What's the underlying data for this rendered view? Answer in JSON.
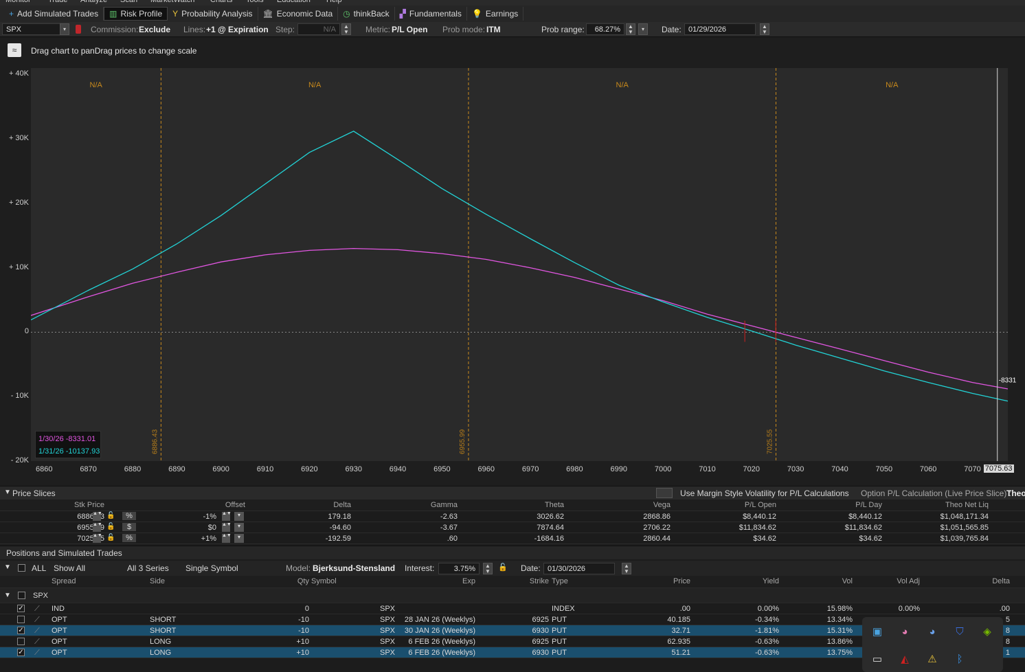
{
  "menubar": {
    "items": [
      "Monitor",
      "Trade",
      "Analyze",
      "Scan",
      "MarketWatch",
      "Charts",
      "Tools",
      "Education",
      "Help"
    ]
  },
  "toolbar": {
    "items": [
      {
        "label": "Add Simulated Trades",
        "icon": "plus-icon"
      },
      {
        "label": "Risk Profile",
        "icon": "risk-profile-icon"
      },
      {
        "label": "Probability Analysis",
        "icon": "probability-icon"
      },
      {
        "label": "Economic Data",
        "icon": "bank-icon"
      },
      {
        "label": "thinkBack",
        "icon": "clock-icon"
      },
      {
        "label": "Fundamentals",
        "icon": "blocks-icon"
      },
      {
        "label": "Earnings",
        "icon": "lightbulb-icon"
      }
    ]
  },
  "controls": {
    "symbol": "SPX",
    "commission_label": "Commission:",
    "commission_value": "Exclude",
    "lines_label": "Lines:",
    "lines_value": "+1 @ Expiration",
    "step_label": "Step:",
    "step_value": "N/A",
    "metric_label": "Metric:",
    "metric_value": "P/L Open",
    "probmode_label": "Prob mode:",
    "probmode_value": "ITM",
    "probrange_label": "Prob range:",
    "probrange_value": "68.27%",
    "date_label": "Date:",
    "date_value": "01/29/2026"
  },
  "chart_hint": "Drag chart to panDrag prices to change scale",
  "chart_data": {
    "type": "line",
    "xlim": [
      6857,
      7078
    ],
    "ylim": [
      -20000,
      41000
    ],
    "x_ticks": [
      6860,
      6870,
      6880,
      6890,
      6900,
      6910,
      6920,
      6930,
      6940,
      6950,
      6960,
      6970,
      6980,
      6990,
      7000,
      7010,
      7020,
      7030,
      7040,
      7050,
      7060,
      7070
    ],
    "y_ticks": [
      {
        "v": 40000,
        "label": "+ 40K"
      },
      {
        "v": 30000,
        "label": "+ 30K"
      },
      {
        "v": 20000,
        "label": "+ 20K"
      },
      {
        "v": 10000,
        "label": "+ 10K"
      },
      {
        "v": 0,
        "label": "0"
      },
      {
        "v": -10000,
        "label": "- 10K"
      },
      {
        "v": -20000,
        "label": "- 20K"
      }
    ],
    "price_lines": [
      {
        "x": 6886.43,
        "label": "6886.43"
      },
      {
        "x": 6955.99,
        "label": "6955.99"
      },
      {
        "x": 7025.55,
        "label": "7025.55"
      }
    ],
    "zone_labels": [
      "N/A",
      "N/A",
      "N/A",
      "N/A"
    ],
    "cursor": {
      "x": 7075.63,
      "label": "7075.63",
      "value_label": "-8331"
    },
    "series": [
      {
        "name": "1/30/26",
        "color": "#e256e2",
        "x": [
          6857,
          6870,
          6880,
          6890,
          6900,
          6910,
          6920,
          6930,
          6940,
          6950,
          6960,
          6970,
          6980,
          6990,
          7000,
          7010,
          7020,
          7030,
          7040,
          7050,
          7060,
          7070,
          7078
        ],
        "y": [
          2600,
          5500,
          7600,
          9300,
          10900,
          12000,
          12700,
          13000,
          12800,
          12200,
          11300,
          10000,
          8500,
          6700,
          4900,
          2800,
          1000,
          -800,
          -2600,
          -4400,
          -6200,
          -7800,
          -8800
        ]
      },
      {
        "name": "1/31/26",
        "color": "#22d3d6",
        "x": [
          6857,
          6870,
          6880,
          6890,
          6900,
          6910,
          6920,
          6930,
          6940,
          6950,
          6960,
          6970,
          6980,
          6990,
          7000,
          7010,
          7020,
          7030,
          7040,
          7050,
          7060,
          7070,
          7078
        ],
        "y": [
          1900,
          6500,
          9800,
          13700,
          18100,
          23000,
          27900,
          31200,
          26800,
          22300,
          18300,
          14500,
          10800,
          7300,
          4700,
          2300,
          200,
          -2000,
          -4000,
          -6000,
          -7800,
          -9500,
          -10700
        ]
      }
    ]
  },
  "legend": [
    {
      "date": "1/30/26",
      "value": "-8331.01",
      "color": "#e256e2"
    },
    {
      "date": "1/31/26",
      "value": "-10137.93",
      "color": "#22d3d6"
    }
  ],
  "slices": {
    "title": "Price Slices",
    "margin_label": "Use Margin Style Volatility for P/L Calculations",
    "option_pl_label": "Option P/L Calculation (Live Price Slice) :",
    "option_pl_value": "Theo",
    "columns": [
      "Stk Price",
      "Offset",
      "Delta",
      "Gamma",
      "Theta",
      "Vega",
      "P/L Open",
      "P/L Day",
      "Theo Net Liq"
    ],
    "rows": [
      {
        "price": "6886.43",
        "unit": "%",
        "offset": "-1%",
        "delta": "179.18",
        "gamma": "-2.63",
        "theta": "3026.62",
        "vega": "2868.86",
        "plopen": "$8,440.12",
        "plday": "$8,440.12",
        "netliq": "$1,048,171.34"
      },
      {
        "price": "6955.99",
        "unit": "$",
        "offset": "$0",
        "delta": "-94.60",
        "gamma": "-3.67",
        "theta": "7874.64",
        "vega": "2706.22",
        "plopen": "$11,834.62",
        "plday": "$11,834.62",
        "netliq": "$1,051,565.85"
      },
      {
        "price": "7025.55",
        "unit": "%",
        "offset": "+1%",
        "delta": "-192.59",
        "gamma": ".60",
        "theta": "-1684.16",
        "vega": "2860.44",
        "plopen": "$34.62",
        "plday": "$34.62",
        "netliq": "$1,039,765.84"
      }
    ]
  },
  "positions": {
    "title": "Positions and Simulated Trades",
    "all_label": "ALL",
    "show_all": "Show All",
    "series": "All 3 Series",
    "single_symbol": "Single Symbol",
    "model_label": "Model:",
    "model_value": "Bjerksund-Stensland",
    "interest_label": "Interest:",
    "interest_value": "3.75%",
    "date_label": "Date:",
    "date_value": "01/30/2026",
    "columns": [
      "Spread",
      "Side",
      "Qty",
      "Symbol",
      "Exp",
      "Strike",
      "Type",
      "Price",
      "Yield",
      "Vol",
      "Vol Adj",
      "Delta"
    ],
    "group": "SPX",
    "rows": [
      {
        "checked": true,
        "selected": false,
        "spread": "IND",
        "side": "",
        "qty": "0",
        "symbol": "SPX",
        "exp": "",
        "strike": "",
        "type": "INDEX",
        "price": ".00",
        "yield": "0.00%",
        "vol": "15.98%",
        "voladj": "0.00%",
        "delta": ".00"
      },
      {
        "checked": false,
        "selected": false,
        "spread": "OPT",
        "side": "SHORT",
        "qty": "-10",
        "symbol": "SPX",
        "exp": "28 JAN 26 (Weeklys)",
        "strike": "6925",
        "type": "PUT",
        "price": "40.185",
        "yield": "-0.34%",
        "vol": "13.34%",
        "voladj": "",
        "delta": "5"
      },
      {
        "checked": true,
        "selected": true,
        "spread": "OPT",
        "side": "SHORT",
        "qty": "-10",
        "symbol": "SPX",
        "exp": "30 JAN 26 (Weeklys)",
        "strike": "6930",
        "type": "PUT",
        "price": "32.71",
        "yield": "-1.81%",
        "vol": "15.31%",
        "voladj": "",
        "delta": "8"
      },
      {
        "checked": false,
        "selected": false,
        "spread": "OPT",
        "side": "LONG",
        "qty": "+10",
        "symbol": "SPX",
        "exp": "6 FEB 26 (Weeklys)",
        "strike": "6925",
        "type": "PUT",
        "price": "62.935",
        "yield": "-0.63%",
        "vol": "13.86%",
        "voladj": "",
        "delta": "8"
      },
      {
        "checked": true,
        "selected": true,
        "spread": "OPT",
        "side": "LONG",
        "qty": "+10",
        "symbol": "SPX",
        "exp": "6 FEB 26 (Weeklys)",
        "strike": "6930",
        "type": "PUT",
        "price": "51.21",
        "yield": "-0.63%",
        "vol": "13.75%",
        "voladj": "",
        "delta": "1"
      }
    ]
  },
  "tray": {
    "icons": [
      "monitor-icon",
      "copilot-icon",
      "copilot-alt-icon",
      "shield-icon",
      "nvidia-icon",
      "tablet-icon",
      "mcafee-icon",
      "defender-warning-icon",
      "bluetooth-icon"
    ]
  }
}
